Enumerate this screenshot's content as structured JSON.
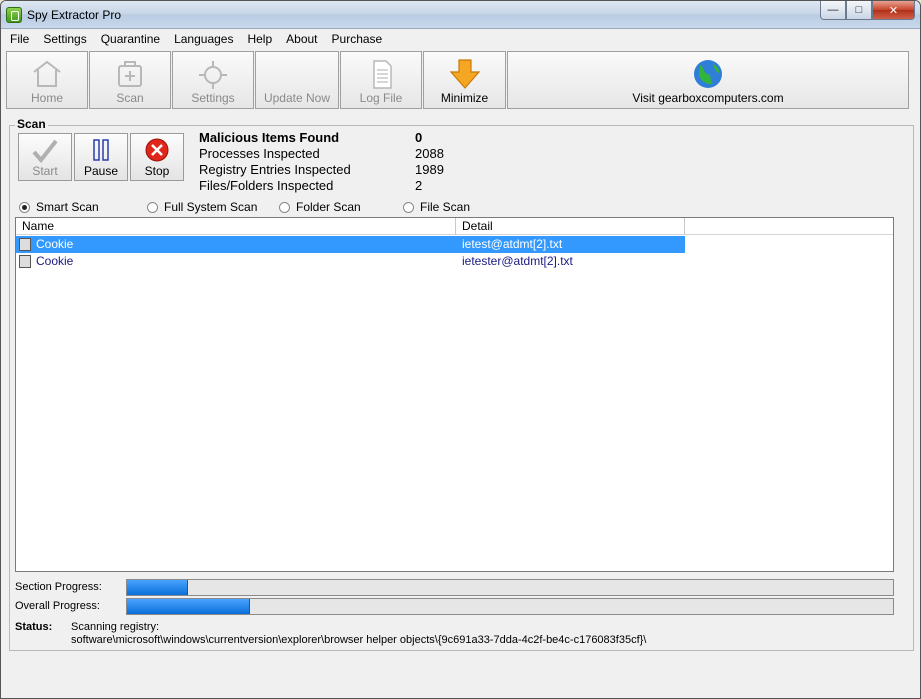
{
  "window": {
    "title": "Spy Extractor Pro"
  },
  "menu": [
    "File",
    "Settings",
    "Quarantine",
    "Languages",
    "Help",
    "About",
    "Purchase"
  ],
  "toolbar": {
    "home": "Home",
    "scan": "Scan",
    "settings": "Settings",
    "update": "Update Now",
    "logfile": "Log File",
    "minimize": "Minimize",
    "visit": "Visit gearboxcomputers.com"
  },
  "scan_group": {
    "title": "Scan",
    "start": "Start",
    "pause": "Pause",
    "stop": "Stop"
  },
  "stats": [
    {
      "label": "Malicious Items Found",
      "value": "0"
    },
    {
      "label": "Processes Inspected",
      "value": "2088"
    },
    {
      "label": "Registry Entries Inspected",
      "value": "1989"
    },
    {
      "label": "Files/Folders Inspected",
      "value": "2"
    }
  ],
  "scan_modes": {
    "selected": "Smart Scan",
    "options": [
      "Smart Scan",
      "Full System Scan",
      "Folder Scan",
      "File Scan"
    ]
  },
  "results": {
    "columns": [
      "Name",
      "Detail"
    ],
    "rows": [
      {
        "name": "Cookie",
        "detail": "ietest@atdmt[2].txt",
        "selected": true
      },
      {
        "name": "Cookie",
        "detail": "ietester@atdmt[2].txt",
        "selected": false
      }
    ]
  },
  "progress": {
    "section_label": "Section Progress:",
    "section_value": 0.08,
    "overall_label": "Overall Progress:",
    "overall_value": 0.16
  },
  "status": {
    "label": "Status:",
    "line1": "Scanning registry:",
    "line2": "software\\microsoft\\windows\\currentversion\\explorer\\browser helper objects\\{9c691a33-7dda-4c2f-be4c-c176083f35cf}\\"
  },
  "colors": {
    "selection": "#3399ff",
    "progress": "#1a7fe8",
    "minimize_arrow": "#f5a623"
  }
}
